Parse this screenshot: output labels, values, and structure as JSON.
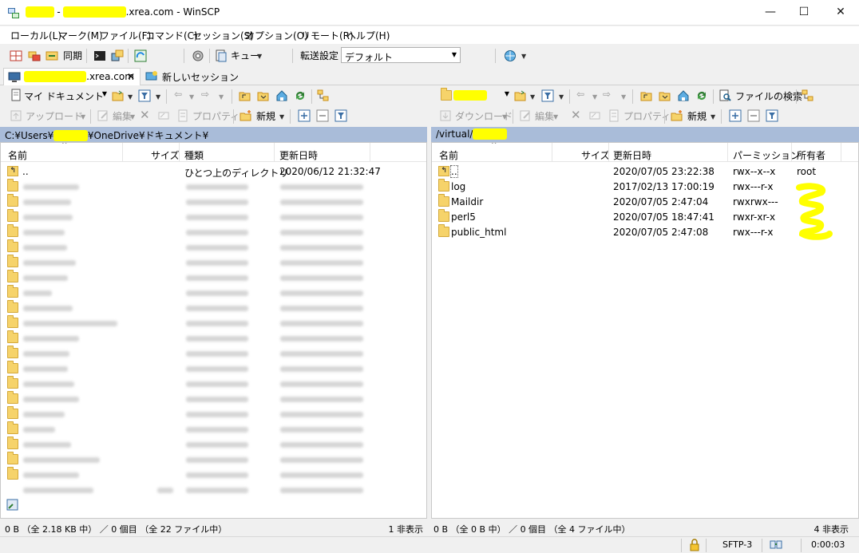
{
  "window": {
    "title_suffix": ".xrea.com - WinSCP",
    "min": "—",
    "max": "☐",
    "close": "✕"
  },
  "menu": [
    "ローカル(L)",
    "マーク(M)",
    "ファイル(F)",
    "コマンド(C)",
    "セッション(S)",
    "オプション(O)",
    "リモート(R)",
    "ヘルプ(H)"
  ],
  "main_toolbar": {
    "sync": "同期",
    "queue": "キュー",
    "transfer_label": "転送設定",
    "transfer_value": "デフォルト"
  },
  "tabs": {
    "session_suffix": ".xrea.com",
    "close": "✕",
    "new_session": "新しいセッション"
  },
  "left": {
    "location": "マイ ドキュメント",
    "upload": "アップロード",
    "edit": "編集",
    "properties": "プロパティ",
    "new": "新規",
    "path_prefix": "C:¥Users¥",
    "path_suffix": "¥OneDrive¥ドキュメント¥",
    "columns": [
      "名前",
      "サイズ",
      "種類",
      "更新日時"
    ],
    "parent": {
      "name": "..",
      "type": "ひとつ上のディレクトリ",
      "modified": "2020/06/12  21:32:47"
    },
    "status_left": "0 B （全 2.18 KB 中） ／ 0 個目 （全 22 ファイル中）",
    "status_right": "1 非表示"
  },
  "right": {
    "download": "ダウンロード",
    "edit": "編集",
    "properties": "プロパティ",
    "new": "新規",
    "find": "ファイルの検索",
    "path_prefix": "/virtual/",
    "columns": [
      "名前",
      "サイズ",
      "更新日時",
      "パーミッション",
      "所有者"
    ],
    "rows": [
      {
        "name": "..",
        "modified": "2020/07/05 23:22:38",
        "perm": "rwx--x--x",
        "owner": "root"
      },
      {
        "name": "log",
        "modified": "2017/02/13 17:00:19",
        "perm": "rwx---r-x",
        "owner": ""
      },
      {
        "name": "Maildir",
        "modified": "2020/07/05 2:47:04",
        "perm": "rwxrwx---",
        "owner": ""
      },
      {
        "name": "perl5",
        "modified": "2020/07/05 18:47:41",
        "perm": "rwxr-xr-x",
        "owner": ""
      },
      {
        "name": "public_html",
        "modified": "2020/07/05 2:47:08",
        "perm": "rwx---r-x",
        "owner": ""
      }
    ],
    "status_left": "0 B （全 0 B 中） ／ 0 個目 （全 4 ファイル中）",
    "status_right": "4 非表示"
  },
  "bottom": {
    "protocol": "SFTP-3",
    "elapsed": "0:00:03"
  }
}
